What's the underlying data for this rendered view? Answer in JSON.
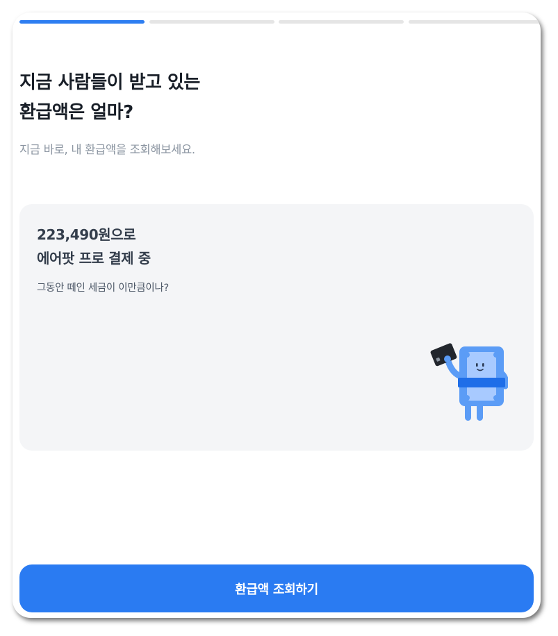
{
  "progress": {
    "total_steps": 4,
    "current_step": 1,
    "colors": {
      "active": "#2e7ef1",
      "inactive": "#e5e5e5"
    }
  },
  "headline": {
    "line1": "지금 사람들이 받고 있는",
    "line2": "환급액은 얼마?"
  },
  "subtitle": "지금 바로, 내 환급액을 조회해보세요.",
  "card": {
    "title_line1": "223,490원으로",
    "title_line2": "에어팟 프로 결제 중",
    "description": "그동안 떼인 세금이 이만큼이나?",
    "illustration": "money-mascot-holding-card-icon"
  },
  "cta": {
    "label": "환급액 조회하기",
    "color": "#2a7bf2"
  }
}
